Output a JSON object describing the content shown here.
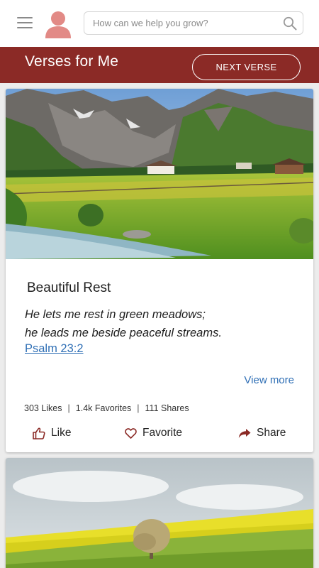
{
  "header": {
    "menu_icon": "hamburger-menu-icon",
    "avatar_icon": "user-avatar-icon",
    "search": {
      "placeholder": "How can we help you grow?",
      "icon": "search-icon"
    }
  },
  "banner": {
    "title": "Verses for Me",
    "next_button_label": "NEXT VERSE"
  },
  "colors": {
    "brand": "#8b2a26",
    "link": "#2f6fb5",
    "avatar": "#e28a86"
  },
  "cards": [
    {
      "image": "mountain-meadow-stream-photo",
      "title": "Beautiful Rest",
      "verse_line_1": "He lets me rest in green meadows;",
      "verse_line_2": "he leads me beside peaceful streams.",
      "reference": "Psalm 23:2",
      "view_more": "View more",
      "stats": {
        "likes": "303 Likes",
        "favorites": "1.4k Favorites",
        "shares": "111 Shares",
        "separator": "|"
      },
      "actions": {
        "like": "Like",
        "favorite": "Favorite",
        "share": "Share"
      }
    },
    {
      "image": "yellow-field-tree-photo"
    }
  ]
}
